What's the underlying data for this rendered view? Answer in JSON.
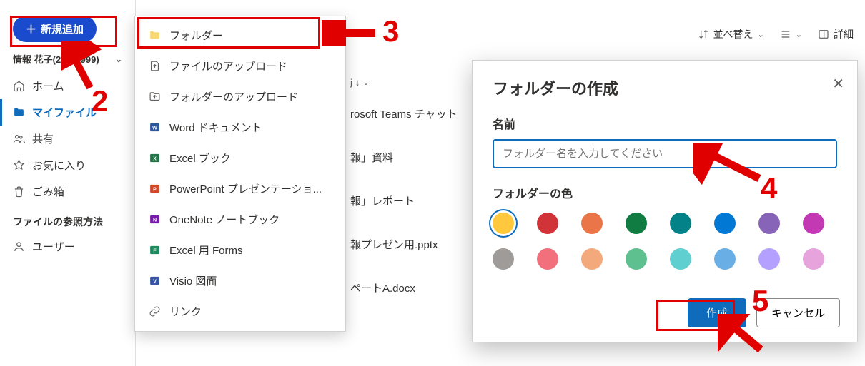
{
  "sidebar": {
    "new_label": "新規追加",
    "user_name": "情報 花子(20IC1999)",
    "items": [
      {
        "icon": "home",
        "label": "ホーム"
      },
      {
        "icon": "folder",
        "label": "マイファイル",
        "active": true
      },
      {
        "icon": "people",
        "label": "共有"
      },
      {
        "icon": "star",
        "label": "お気に入り"
      },
      {
        "icon": "trash",
        "label": "ごみ箱"
      }
    ],
    "section_title": "ファイルの参照方法",
    "extra": [
      {
        "icon": "person",
        "label": "ユーザー"
      }
    ]
  },
  "create_menu": {
    "items": [
      {
        "icon": "folder-fill",
        "label": "フォルダー"
      },
      {
        "icon": "upload-file",
        "label": "ファイルのアップロード"
      },
      {
        "icon": "upload-folder",
        "label": "フォルダーのアップロード"
      },
      {
        "icon": "word",
        "label": "Word ドキュメント"
      },
      {
        "icon": "excel",
        "label": "Excel ブック"
      },
      {
        "icon": "ppt",
        "label": "PowerPoint プレゼンテーショ..."
      },
      {
        "icon": "onenote",
        "label": "OneNote ノートブック"
      },
      {
        "icon": "forms",
        "label": "Excel 用 Forms"
      },
      {
        "icon": "visio",
        "label": "Visio 図面"
      },
      {
        "icon": "link",
        "label": "リンク"
      }
    ]
  },
  "toolbar": {
    "sort_label": "並べ替え",
    "details_label": "詳細"
  },
  "bg_column_header": "j",
  "bg_rows": [
    "rosoft Teams チャット",
    "報」資料",
    "報」レポート",
    "報プレゼン用.pptx",
    "ペートA.docx"
  ],
  "dialog": {
    "title": "フォルダーの作成",
    "name_label": "名前",
    "name_placeholder": "フォルダー名を入力してください",
    "color_label": "フォルダーの色",
    "colors_row1": [
      "#ffc83d",
      "#d13438",
      "#e97548",
      "#107c41",
      "#038387",
      "#0078d4",
      "#8764b8",
      "#c239b3"
    ],
    "colors_row2": [
      "#9e9b98",
      "#f1707b",
      "#f4a97c",
      "#5ec08f",
      "#5fcfd0",
      "#69afe5",
      "#b4a0ff",
      "#e6a3dc"
    ],
    "create_label": "作成",
    "cancel_label": "キャンセル"
  },
  "annotations": {
    "n2": "2",
    "n3": "3",
    "n4": "4",
    "n5": "5"
  }
}
